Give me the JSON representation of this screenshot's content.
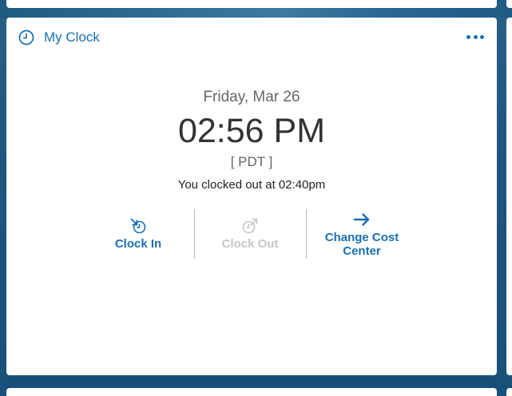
{
  "card": {
    "title": "My Clock",
    "title_icon": "clock-icon",
    "more_icon": "more-horizontal-icon"
  },
  "clock": {
    "date": "Friday, Mar 26",
    "time": "02:56 PM",
    "timezone": "[ PDT ]",
    "status": "You clocked out at 02:40pm"
  },
  "actions": [
    {
      "label": "Clock In",
      "icon": "clock-in-icon",
      "enabled": true
    },
    {
      "label": "Clock Out",
      "icon": "clock-out-icon",
      "enabled": false
    },
    {
      "label": "Change Cost Center",
      "icon": "arrow-right-icon",
      "enabled": true
    }
  ],
  "colors": {
    "accent": "#1a6fb3",
    "disabled": "#c6c6c6",
    "background": "#20577f",
    "text": "#333333"
  }
}
